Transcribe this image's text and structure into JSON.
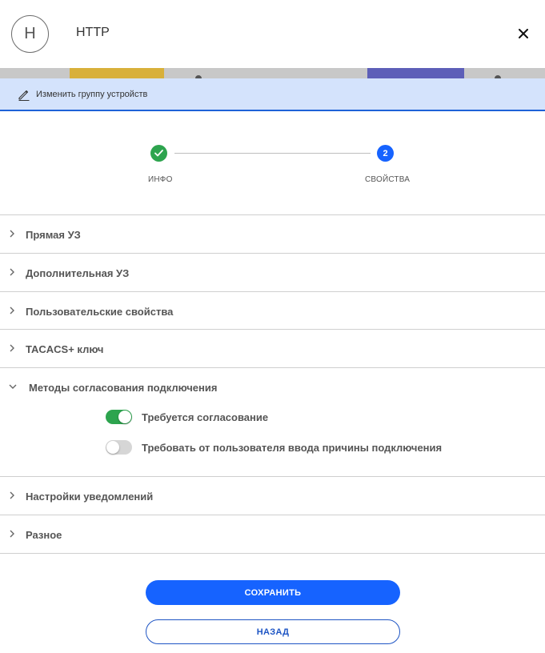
{
  "header": {
    "avatar_letter": "H",
    "title": "HTTP"
  },
  "edit_bar": {
    "label": "Изменить группу устройств"
  },
  "stepper": {
    "steps": [
      {
        "label": "ИНФО",
        "status": "done"
      },
      {
        "label": "СВОЙСТВА",
        "number": "2",
        "status": "active"
      }
    ]
  },
  "sections": [
    {
      "label": "Прямая УЗ",
      "expanded": false
    },
    {
      "label": "Дополнительная УЗ",
      "expanded": false
    },
    {
      "label": "Пользовательские свойства",
      "expanded": false
    },
    {
      "label": "TACACS+ ключ",
      "expanded": false
    },
    {
      "label": "Методы согласования подключения",
      "expanded": true
    },
    {
      "label": "Настройки уведомлений",
      "expanded": false
    },
    {
      "label": "Разное",
      "expanded": false
    }
  ],
  "approval": {
    "toggles": [
      {
        "label": "Требуется согласование",
        "on": true
      },
      {
        "label": "Требовать от пользователя ввода причины подключения",
        "on": false
      }
    ]
  },
  "buttons": {
    "save": "СОХРАНИТЬ",
    "back": "НАЗАД"
  },
  "colors": {
    "accent": "#1663ff",
    "success": "#2da44e",
    "edit_bar_bg": "#d4e3fc"
  }
}
